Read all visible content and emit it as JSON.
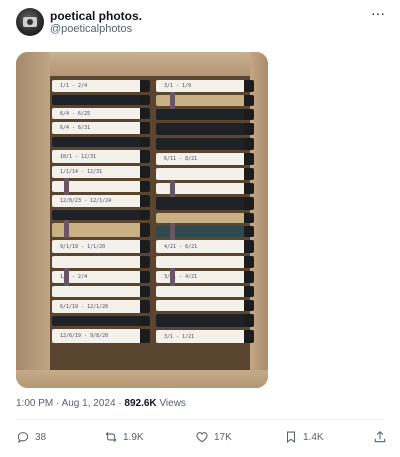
{
  "author": {
    "display_name": "poetical photos.",
    "handle": "@poeticalphotos",
    "avatar_icon": "camera-avatar-icon"
  },
  "more_menu": "···",
  "photo": {
    "left_labels": [
      "1/1 - 2/4",
      "",
      "6/4 - 6/25",
      "6/4 - 6/31",
      "",
      "10/1 - 12/31",
      "1/1/14 - 12/31",
      "",
      "12/8/23 - 12/1/24",
      "",
      "",
      "9/1/19 - 1/1/20",
      "",
      "1/1 - 2/4",
      "",
      "6/1/19 - 12/1/20",
      "",
      "12/6/19 - 9/8/20"
    ],
    "right_labels": [
      "3/1 - 1/9",
      "",
      "",
      "",
      "",
      "6/11 - 8/21",
      "",
      "",
      "",
      "",
      "",
      "4/21 - 6/21",
      "",
      "3/21 - 4/21",
      "",
      "",
      "",
      "3/1 - 1/21"
    ]
  },
  "timestamp": "1:00 PM · Aug 1, 2024",
  "meta_sep": " · ",
  "views": {
    "count": "892.6K",
    "label": "Views"
  },
  "actions": {
    "reply": {
      "icon": "reply-icon",
      "count": "38"
    },
    "retweet": {
      "icon": "retweet-icon",
      "count": "1.9K"
    },
    "like": {
      "icon": "heart-icon",
      "count": "17K"
    },
    "bookmark": {
      "icon": "bookmark-icon",
      "count": "1.4K"
    },
    "share": {
      "icon": "share-icon"
    }
  },
  "colors": {
    "text": "#0f1419",
    "secondary": "#536471",
    "divider": "#eff3f4"
  }
}
